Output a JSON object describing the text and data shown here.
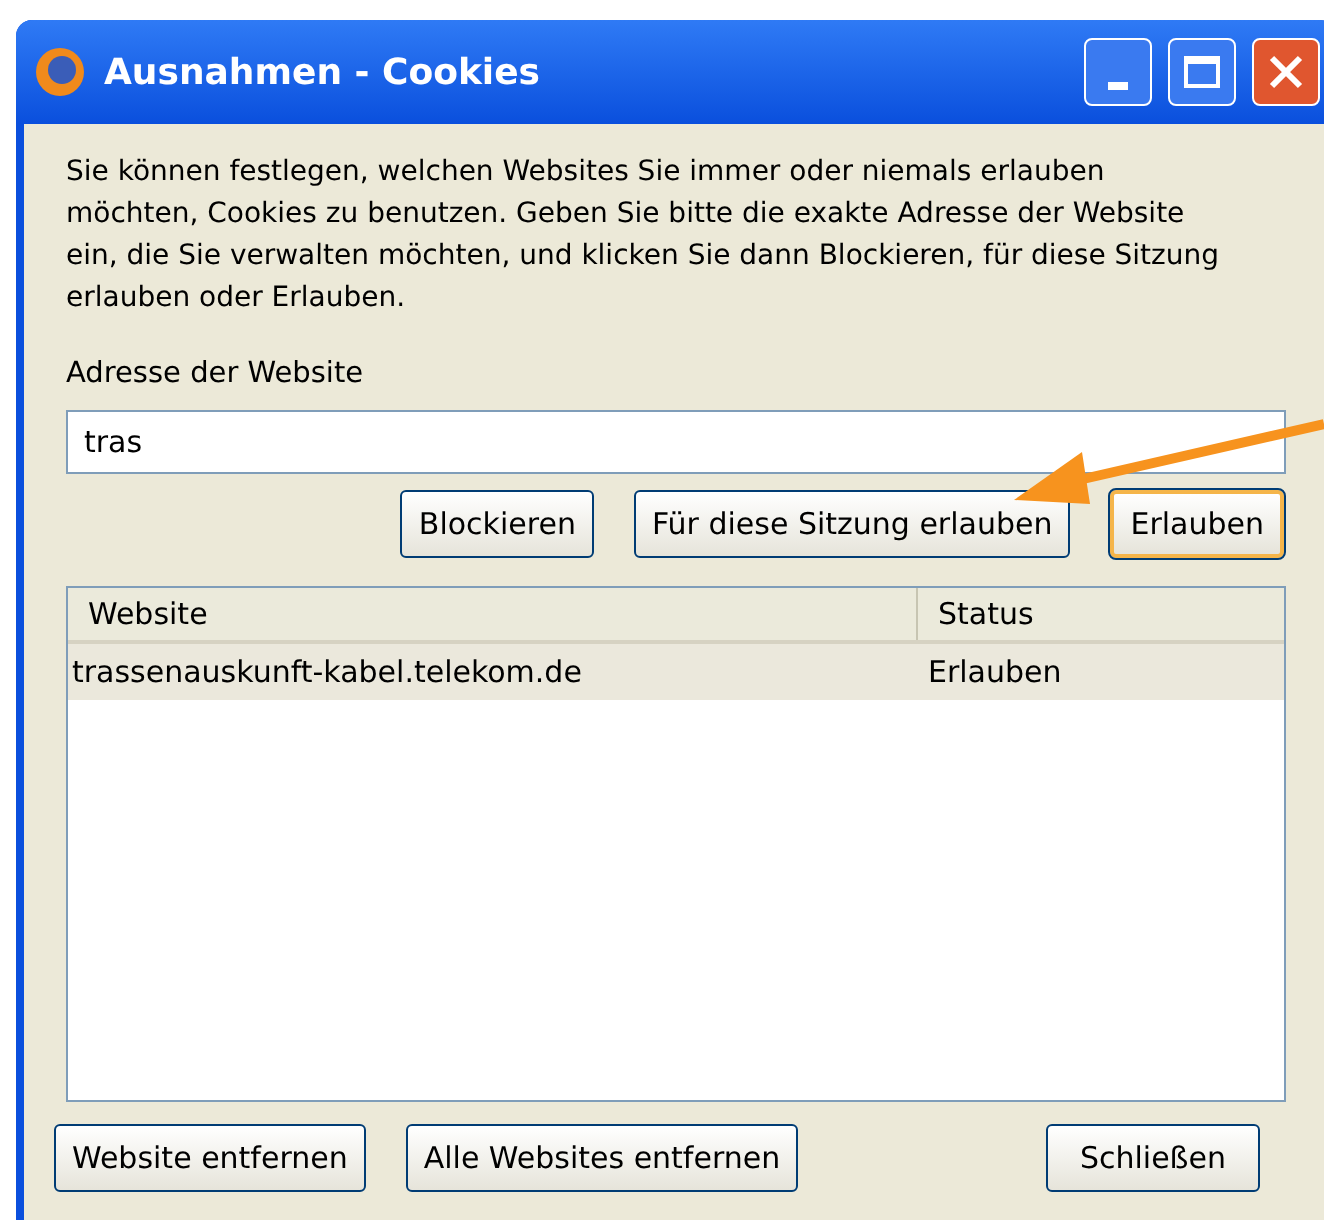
{
  "window": {
    "title": "Ausnahmen - Cookies"
  },
  "description": "Sie können festlegen, welchen Websites Sie immer oder niemals erlauben möchten, Cookies zu benutzen. Geben Sie bitte die exakte Adresse der Website ein, die Sie verwalten möchten, und klicken Sie dann Blockieren, für diese Sitzung erlauben oder Erlauben.",
  "address": {
    "label": "Adresse der Website",
    "value": "tras"
  },
  "action_buttons": [
    {
      "label": "Blockieren",
      "default": false
    },
    {
      "label": "Für diese Sitzung erlauben",
      "default": false
    },
    {
      "label": "Erlauben",
      "default": true
    }
  ],
  "table": {
    "columns": [
      "Website",
      "Status"
    ],
    "rows": [
      {
        "website": "trassenauskunft-kabel.telekom.de",
        "status": "Erlauben",
        "selected": true
      }
    ]
  },
  "footer_buttons": [
    "Website entfernen",
    "Alle Websites entfernen",
    "Schließen"
  ]
}
